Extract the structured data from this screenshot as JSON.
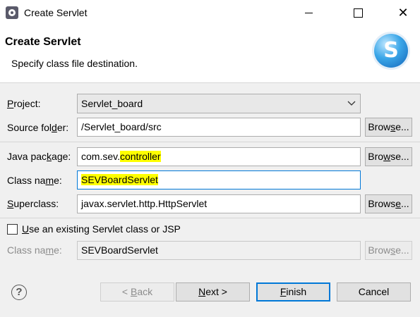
{
  "window": {
    "title": "Create Servlet",
    "minimize_glyph": "",
    "maximize_glyph": "",
    "close_glyph": "✕"
  },
  "header": {
    "title": "Create Servlet",
    "description": "Specify class file destination.",
    "logo_letter": "S"
  },
  "form": {
    "project": {
      "label_u": "P",
      "label_rest": "roject:",
      "value": "Servlet_board"
    },
    "source_folder": {
      "label_pre": "Source fol",
      "label_u": "d",
      "label_post": "er:",
      "value": "/Servlet_board/src",
      "browse_pre": "Brow",
      "browse_u": "s",
      "browse_post": "e..."
    },
    "java_package": {
      "label_pre": "Java pac",
      "label_u": "k",
      "label_post": "age:",
      "value_plain": "com.sev.",
      "value_highlight": "controller",
      "browse_pre": "Bro",
      "browse_u": "w",
      "browse_post": "se..."
    },
    "class_name": {
      "label_pre": "Class na",
      "label_u": "m",
      "label_post": "e:",
      "value": "SEVBoardServlet"
    },
    "superclass": {
      "label_u": "S",
      "label_rest": "uperclass:",
      "value": "javax.servlet.http.HttpServlet",
      "browse_pre": "Brows",
      "browse_u": "e",
      "browse_post": "..."
    },
    "existing": {
      "label_u": "U",
      "label_rest": "se an existing Servlet class or JSP"
    },
    "existing_class_name": {
      "label_pre": "Class na",
      "label_u": "m",
      "label_post": "e:",
      "value": "SEVBoardServlet",
      "browse_pre": "Brow",
      "browse_u": "s",
      "browse_post": "e..."
    }
  },
  "footer": {
    "help_glyph": "?",
    "back": {
      "pre": "< ",
      "u": "B",
      "post": "ack"
    },
    "next": {
      "u": "N",
      "post": "ext >"
    },
    "finish": {
      "u": "F",
      "post": "inish"
    },
    "cancel": "Cancel"
  },
  "colors": {
    "highlight": "#ffff00",
    "focus": "#0078d7",
    "logo": "#1e88d8"
  }
}
